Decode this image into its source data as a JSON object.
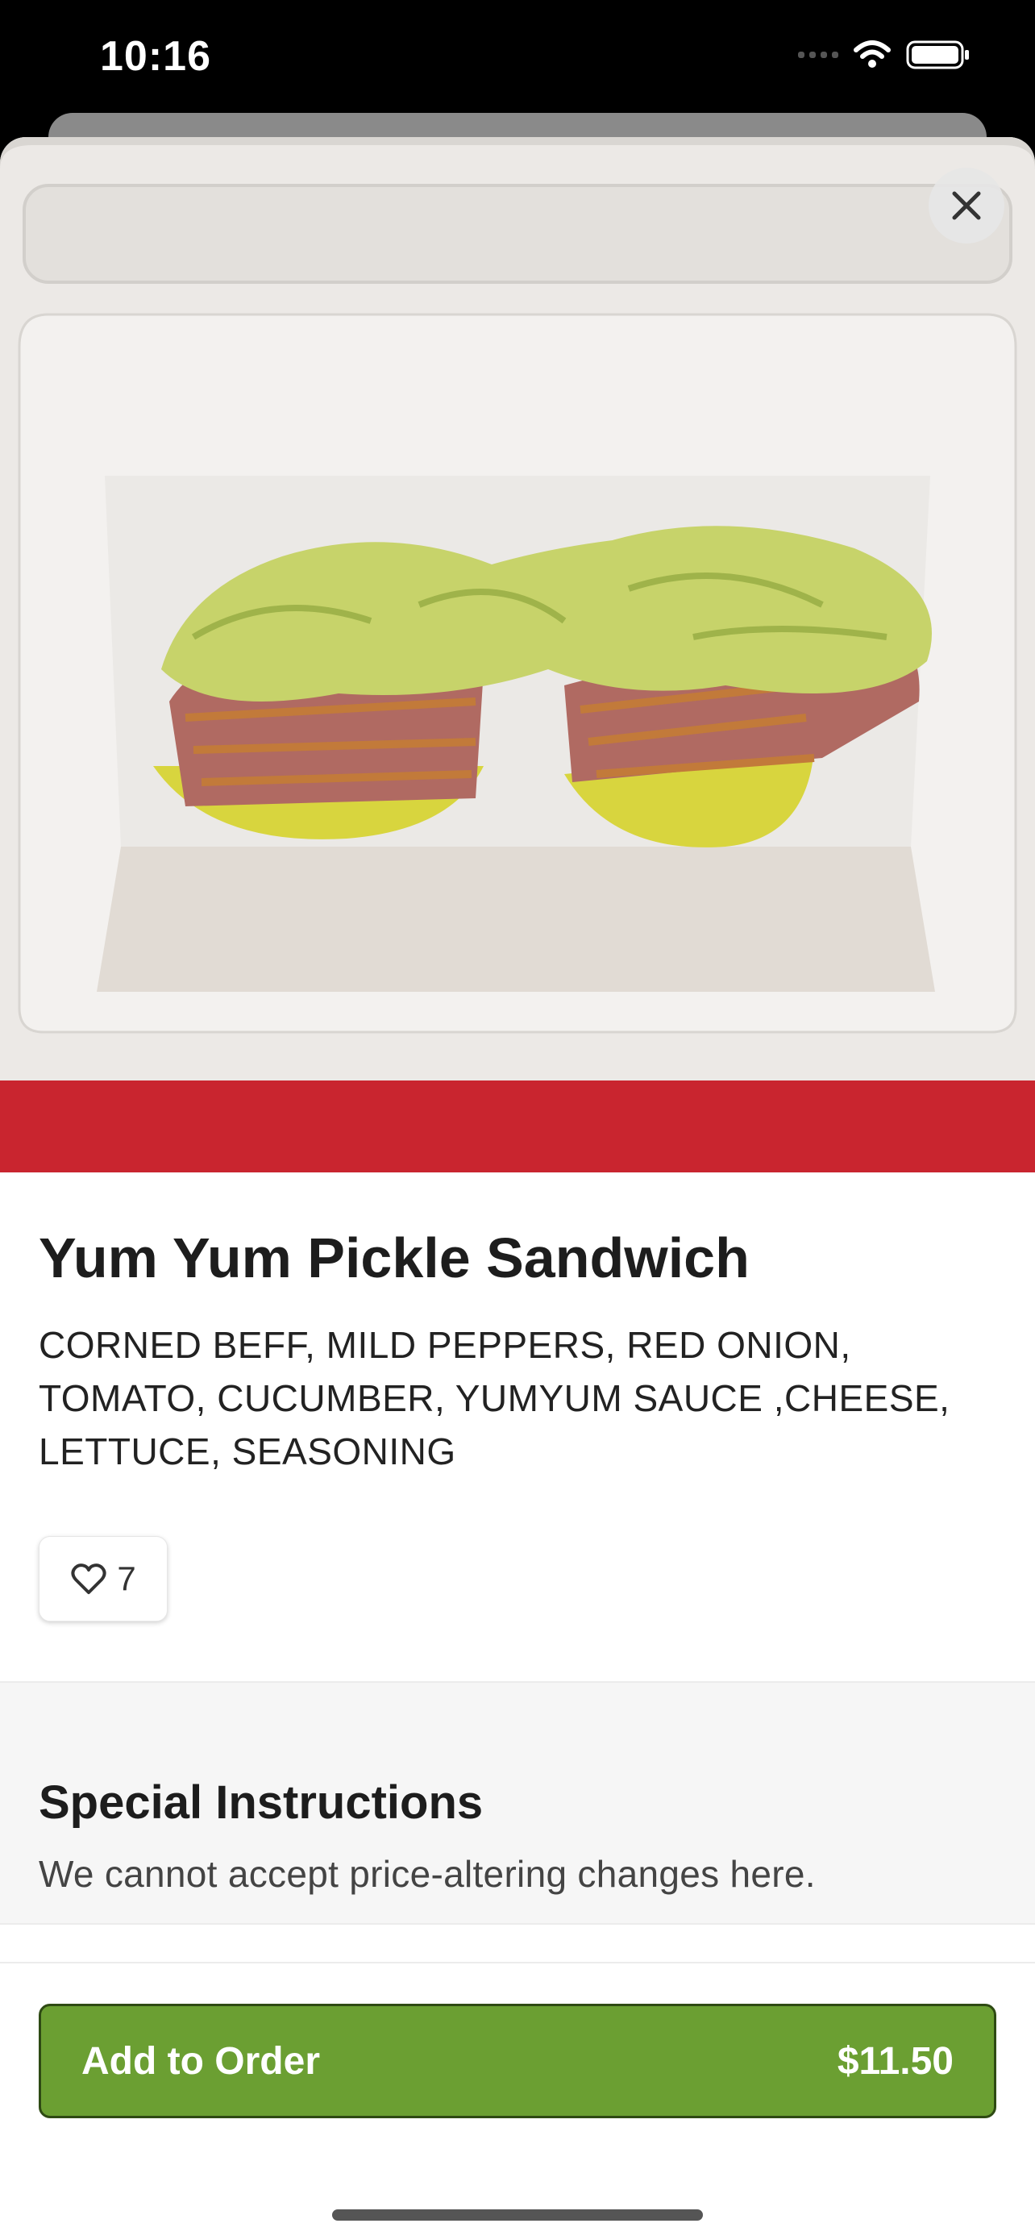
{
  "status_bar": {
    "time": "10:16"
  },
  "item": {
    "name": "Yum Yum Pickle Sandwich",
    "description": "CORNED BEFF, MILD PEPPERS, RED ONION, TOMATO, CUCUMBER, YUMYUM SAUCE ,CHEESE, LETTUCE, SEASONING",
    "likes": "7"
  },
  "special_instructions": {
    "title": "Special Instructions",
    "subtitle": "We cannot accept price-altering changes here."
  },
  "order_button": {
    "label": "Add to Order",
    "price": "$11.50"
  },
  "colors": {
    "accent_green": "#6b9f32",
    "tray_red": "#c9252f"
  },
  "icons": {
    "close": "close-icon",
    "like": "heart-icon",
    "wifi": "wifi-icon",
    "battery": "battery-icon"
  }
}
